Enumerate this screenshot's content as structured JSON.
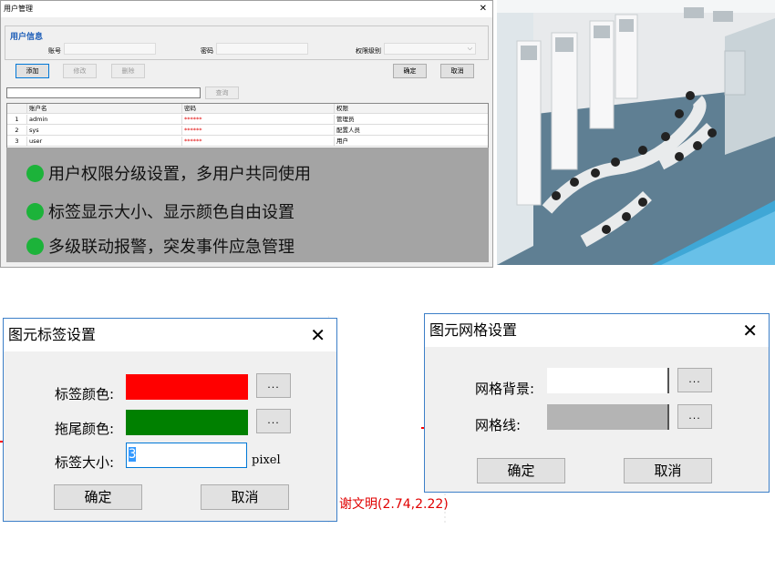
{
  "user_window": {
    "title": "用户管理",
    "close_glyph": "✕",
    "group_title": "用户信息",
    "account_label": "账号",
    "password_label": "密码",
    "level_label": "权限级别",
    "buttons": {
      "add": "添加",
      "modify": "修改",
      "delete": "删除",
      "ok": "确定",
      "cancel": "取消",
      "search": "查询"
    },
    "table": {
      "headers": [
        "",
        "账户名",
        "密码",
        "权限"
      ],
      "rows": [
        {
          "no": "1",
          "name": "admin",
          "password": "******",
          "role": "管理员"
        },
        {
          "no": "2",
          "name": "sys",
          "password": "******",
          "role": "配置人员"
        },
        {
          "no": "3",
          "name": "user",
          "password": "******",
          "role": "用户"
        }
      ]
    }
  },
  "features": [
    "用户权限分级设置，多用户共同使用",
    "标签显示大小、显示颜色自由设置",
    "多级联动报警，突发事件应急管理"
  ],
  "label_dialog": {
    "title": "图元标签设置",
    "close_glyph": "✕",
    "label_color": "标签颜色:",
    "tail_color": "拖尾颜色:",
    "label_size": "标签大小:",
    "size_value": "3",
    "unit": "pixel",
    "browse": "...",
    "ok": "确定",
    "cancel": "取消",
    "colors": {
      "label": "#ff0000",
      "tail": "#008000"
    }
  },
  "grid_dialog": {
    "title": "图元网格设置",
    "close_glyph": "✕",
    "background_label": "网格背景:",
    "line_label": "网格线:",
    "browse": "...",
    "ok": "确定",
    "cancel": "取消",
    "colors": {
      "background": "#ffffff",
      "line": "#b4b4b4"
    }
  },
  "canvas": {
    "label_text": "谢文明(2.74,2.22)"
  },
  "colors": {
    "accent_blue": "#1f5fb8",
    "feature_green": "#1cb33a"
  }
}
